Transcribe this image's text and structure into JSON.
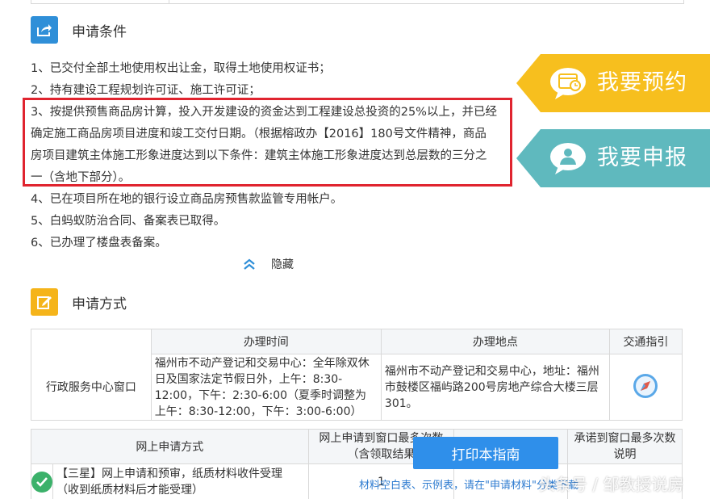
{
  "conditions": {
    "title": "申请条件",
    "items": [
      "1、已交付全部土地使用权出让金，取得土地使用权证书；",
      "2、持有建设工程规划许可证、施工许可证；",
      "4、已在项目所在地的银行设立商品房预售款监管专用帐户。",
      "5、白蚂蚁防治合同、备案表已取得。",
      "6、已办理了楼盘表备案。"
    ],
    "highlighted_lines": [
      "3、按提供预售商品房计算，投入开发建设的资金达到工程建设总投资的25%以上，并已经",
      "确定施工商品房项目进度和竣工交付日期。（根据榕政办【2016】180号文件精神，商品",
      "房项目建筑主体施工形象进度达到以下条件：建筑主体施工形象进度达到总层数的三分之",
      "一（含地下部分）。"
    ],
    "toggle_label": "隐藏"
  },
  "side_buttons": {
    "appointment": "我要预约",
    "apply": "我要申报"
  },
  "method": {
    "title": "申请方式",
    "table": {
      "headers": [
        "办理时间",
        "办理地点",
        "交通指引"
      ],
      "row_label": "行政服务中心窗口",
      "time": "福州市不动产登记和交易中心：全年除双休日及国家法定节假日外，上午：8:30-12:00，下午：2:30-6:00（夏季时调整为上午：8:30-12:00，下午：3:00-6:00）",
      "location": "福州市不动产登记和交易中心，地址：福州市鼓楼区福屿路200号房地产综合大楼三层301。"
    },
    "online": {
      "headers": [
        "网上申请方式",
        "网上申请到窗口最多次数（含领取结果",
        "承诺到窗口最多次数说明"
      ],
      "row_text": "【三星】网上申请和预审，纸质材料收件受理（收到纸质材料后才能受理）",
      "count_visible": "1"
    }
  },
  "print_button": "打印本指南",
  "links_text": "材料空白表、示例表，请在\"申请材料\"分类下载",
  "watermark": "头条号 / 邹教授说房",
  "colors": {
    "blue_icon": "#2f8fd8",
    "orange_icon": "#f5b41a",
    "highlight_border": "#e0242f",
    "flag_yellow": "#f7bf1e",
    "flag_teal": "#5fb9be",
    "print_button": "#2f8fea",
    "check_green": "#3bb16a"
  }
}
